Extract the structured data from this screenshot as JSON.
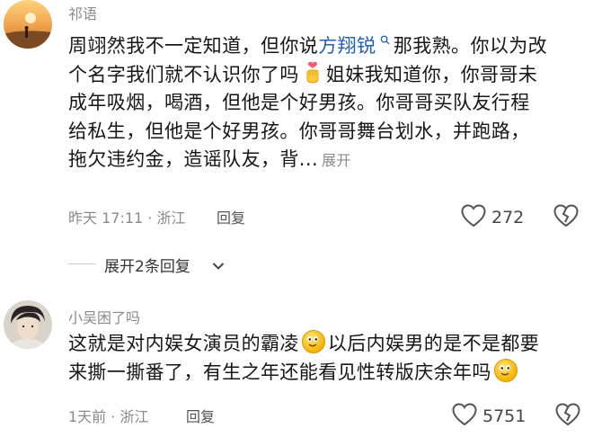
{
  "comments": [
    {
      "username": "祁语",
      "lines": [
        {
          "pre": "周翊然我不一定知道，但你说",
          "link": "方翔锐",
          "post": "那我熟。你以为改"
        },
        {
          "pre": "个名字我们就不认识你了吗",
          "post": "姐妹我知道你，你哥哥未"
        },
        {
          "text": "成年吸烟，喝酒，但他是个好男孩。你哥哥买队友行程"
        },
        {
          "text": "给私生，但他是个好男孩。你哥哥舞台划水，并跑路，"
        },
        {
          "text": "拖欠违约金，造谣队友，背...",
          "expand": "展开"
        }
      ],
      "meta": "昨天 17:11 · 浙江",
      "reply": "回复",
      "likes": "272"
    },
    {
      "username": "小吴困了吗",
      "lines": [
        {
          "pre": "这就是对内娱女演员的霸凌",
          "post": "以后内娱男的是不是都要"
        },
        {
          "pre": "来撕一撕番了，有生之年还能看见性转版庆余年吗"
        }
      ],
      "meta": "1天前 · 浙江",
      "reply": "回复",
      "likes": "5751"
    }
  ],
  "expand_replies": "展开2条回复",
  "icons": {
    "like": "heart-outline-icon",
    "dislike": "broken-heart-icon",
    "search": "search-icon",
    "chevron": "chevron-down-icon",
    "emoji1": "finger-heart-emoji",
    "emoji2": "smile-emoji"
  },
  "colors": {
    "link": "#1f5fb8",
    "meta": "#8a8a8a",
    "text": "#161616"
  }
}
